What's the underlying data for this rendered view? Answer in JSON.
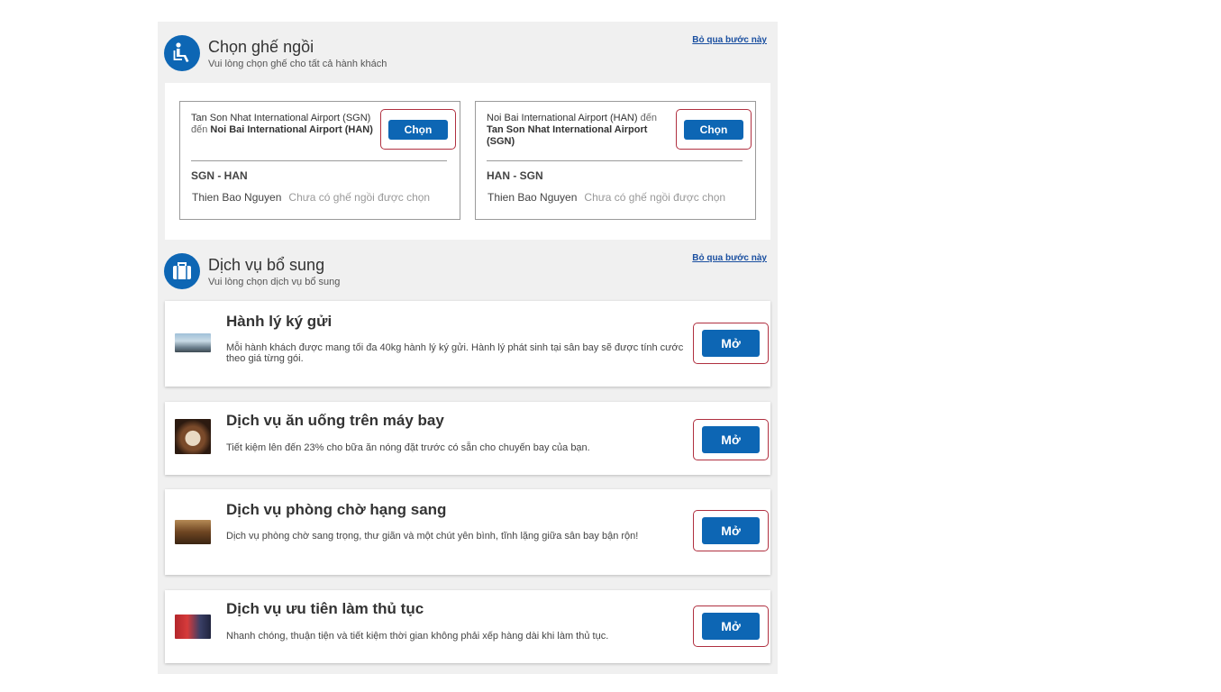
{
  "seat_section": {
    "title": "Chọn ghế ngồi",
    "subtitle": "Vui lòng chọn ghế cho tất cả hành khách",
    "skip_link": "Bỏ qua bước này",
    "icon": "seat-icon",
    "flights": [
      {
        "origin": "Tan Son Nhat International Airport (SGN)",
        "connector": "đến",
        "destination": "Noi Bai International Airport (HAN)",
        "choose_label": "Chọn",
        "route_code": "SGN - HAN",
        "passenger_name": "Thien Bao Nguyen",
        "seat_status": "Chưa có ghế ngồi được chọn"
      },
      {
        "origin": "Noi Bai International Airport (HAN)",
        "connector": "đến",
        "destination": "Tan Son Nhat International Airport (SGN)",
        "choose_label": "Chọn",
        "route_code": "HAN - SGN",
        "passenger_name": "Thien Bao Nguyen",
        "seat_status": "Chưa có ghế ngồi được chọn"
      }
    ]
  },
  "extras_section": {
    "title": "Dịch vụ bổ sung",
    "subtitle": "Vui lòng chọn dịch vụ bổ sung",
    "skip_link": "Bỏ qua bước này",
    "icon": "baggage-icon",
    "services": [
      {
        "title": "Hành lý ký gửi",
        "description": "Mỗi hành khách được mang tối đa 40kg hành lý ký gửi. Hành lý phát sinh tại sân bay sẽ được tính cước theo giá từng gói.",
        "button_label": "Mở",
        "image": "baggage-photo"
      },
      {
        "title": "Dịch vụ ăn uống trên máy bay",
        "description": "Tiết kiệm lên đến 23% cho bữa ăn nóng đặt trước có sẵn cho chuyến bay của bạn.",
        "button_label": "Mở",
        "image": "meal-photo"
      },
      {
        "title": "Dịch vụ phòng chờ hạng sang",
        "description": "Dịch vụ phòng chờ sang trọng, thư giãn và một chút yên bình, tĩnh lặng giữa sân bay bận rộn!",
        "button_label": "Mở",
        "image": "lounge-photo"
      },
      {
        "title": "Dịch vụ ưu tiên làm thủ tục",
        "description": "Nhanh chóng, thuận tiện và tiết kiệm thời gian không phải xếp hàng dài khi làm thủ tục.",
        "button_label": "Mở",
        "image": "priority-checkin-photo"
      }
    ]
  },
  "colors": {
    "primary_blue": "#0d66b4",
    "highlight_outline": "#b03040",
    "panel_background": "#f0f0f0"
  }
}
